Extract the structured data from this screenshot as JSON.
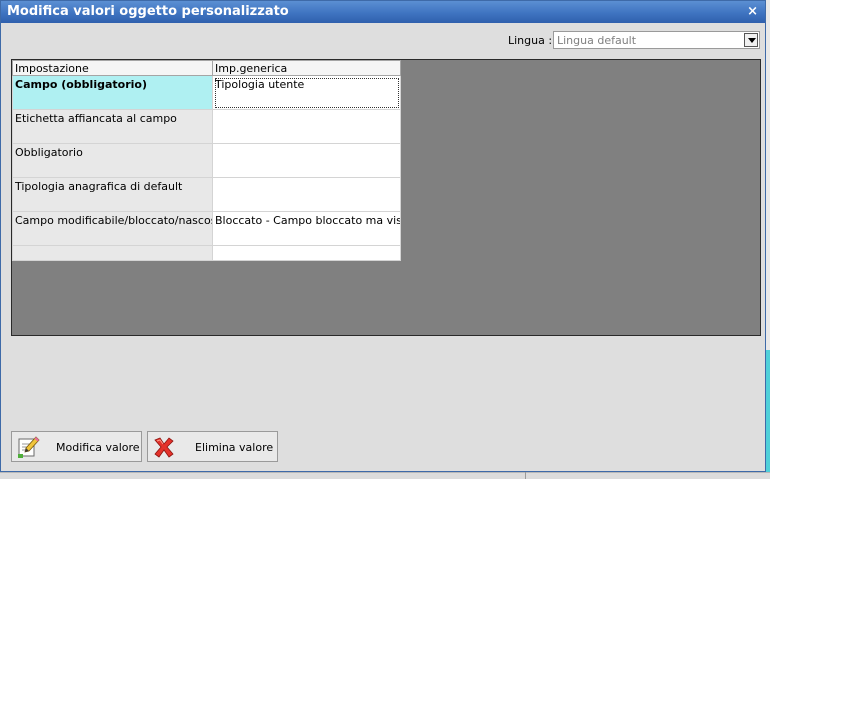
{
  "dialog": {
    "title": "Modifica valori oggetto personalizzato",
    "close_glyph": "×"
  },
  "language": {
    "label": "Lingua :",
    "selected": "Lingua default"
  },
  "grid": {
    "headers": [
      "Impostazione",
      "Imp.generica"
    ],
    "rows": [
      {
        "setting": "Campo (obbligatorio)",
        "value": "Tipologia utente"
      },
      {
        "setting": "Etichetta affiancata al campo",
        "value": ""
      },
      {
        "setting": "Obbligatorio",
        "value": ""
      },
      {
        "setting": "Tipologia anagrafica di default",
        "value": ""
      },
      {
        "setting": "Campo modificabile/bloccato/nascosto",
        "value": "Bloccato - Campo bloccato ma visibile"
      },
      {
        "setting": "",
        "value": ""
      }
    ],
    "selected_row": 0
  },
  "buttons": {
    "modifica": "Modifica valore",
    "elimina": "Elimina valore"
  },
  "icons": {
    "modifica": "edit-pencil-icon",
    "elimina": "delete-x-icon"
  },
  "colors": {
    "titlebar": "#3f74c1",
    "selected_row": "#aff0f2",
    "grid_background": "#808080",
    "delete_icon": "#e4322b"
  }
}
